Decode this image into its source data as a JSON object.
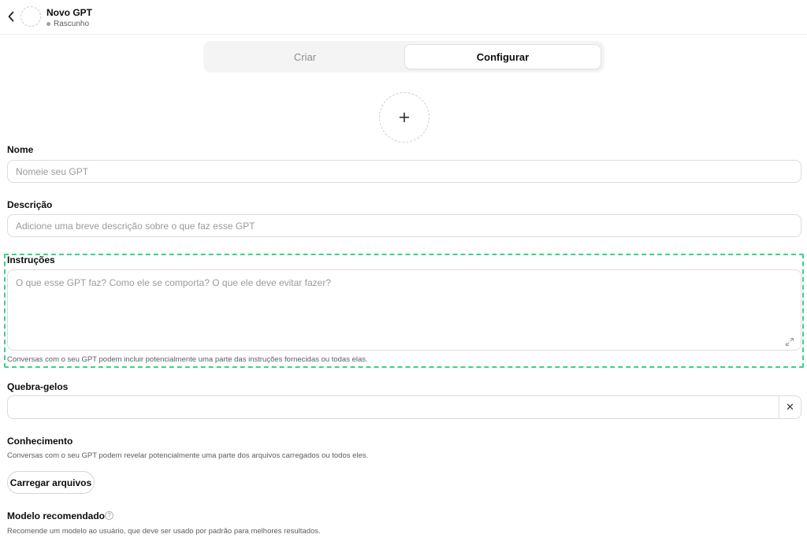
{
  "header": {
    "title": "Novo GPT",
    "status": "Rascunho"
  },
  "tabs": [
    {
      "label": "Criar",
      "active": false
    },
    {
      "label": "Configurar",
      "active": true
    }
  ],
  "form": {
    "name": {
      "label": "Nome",
      "placeholder": "Nomeie seu GPT",
      "value": ""
    },
    "description": {
      "label": "Descrição",
      "placeholder": "Adicione uma breve descrição sobre o que faz esse GPT",
      "value": ""
    },
    "instructions": {
      "label": "Instruções",
      "placeholder": "O que esse GPT faz? Como ele se comporta? O que ele deve evitar fazer?",
      "value": "",
      "hint": "Conversas com o seu GPT podem incluir potencialmente uma parte das instruções fornecidas ou todas elas."
    },
    "conversation_starters": {
      "label": "Quebra-gelos",
      "value": "",
      "remove_symbol": "✕"
    },
    "knowledge": {
      "label": "Conhecimento",
      "hint": "Conversas com o seu GPT podem revelar potencialmente uma parte dos arquivos carregados ou todos eles.",
      "upload_label": "Carregar arquivos"
    },
    "recommended_model": {
      "label": "Modelo recomendado",
      "help_symbol": "?",
      "hint": "Recomende um modelo ao usuário, que deve ser usado por padrão para melhores resultados."
    }
  },
  "icons": {
    "back": "chevron-left-icon",
    "add_avatar": "plus-icon",
    "expand": "expand-icon",
    "remove": "close-icon",
    "help": "help-icon"
  },
  "colors": {
    "highlight": "#3ecf8e",
    "text": "#0d0d0d",
    "muted": "#5d5d5d",
    "placeholder": "#9b9b9b",
    "border": "#dcdcdc",
    "tab_bg": "#f4f4f4"
  }
}
